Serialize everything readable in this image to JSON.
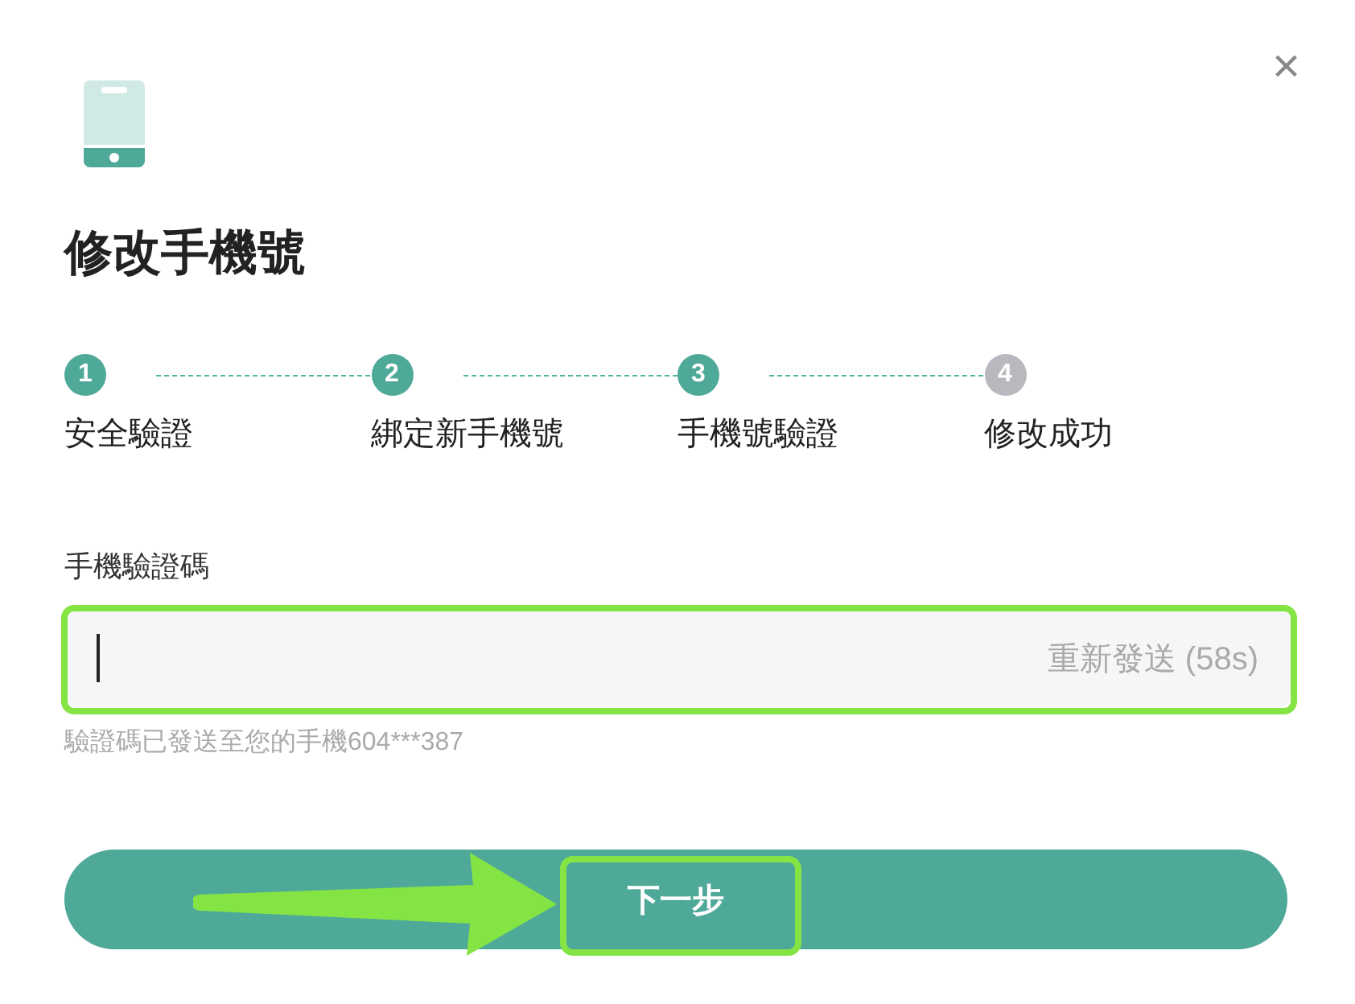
{
  "dialog": {
    "title": "修改手機號",
    "close": "×"
  },
  "steps": [
    {
      "number": "1",
      "label": "安全驗證",
      "completed": true
    },
    {
      "number": "2",
      "label": "綁定新手機號",
      "completed": true
    },
    {
      "number": "3",
      "label": "手機號驗證",
      "completed": true
    },
    {
      "number": "4",
      "label": "修改成功",
      "completed": false
    }
  ],
  "code_field": {
    "label": "手機驗證碼",
    "resend": "重新發送 (58s)",
    "hint": "驗證碼已發送至您的手機604***387"
  },
  "next_button": {
    "label": "下一步"
  }
}
